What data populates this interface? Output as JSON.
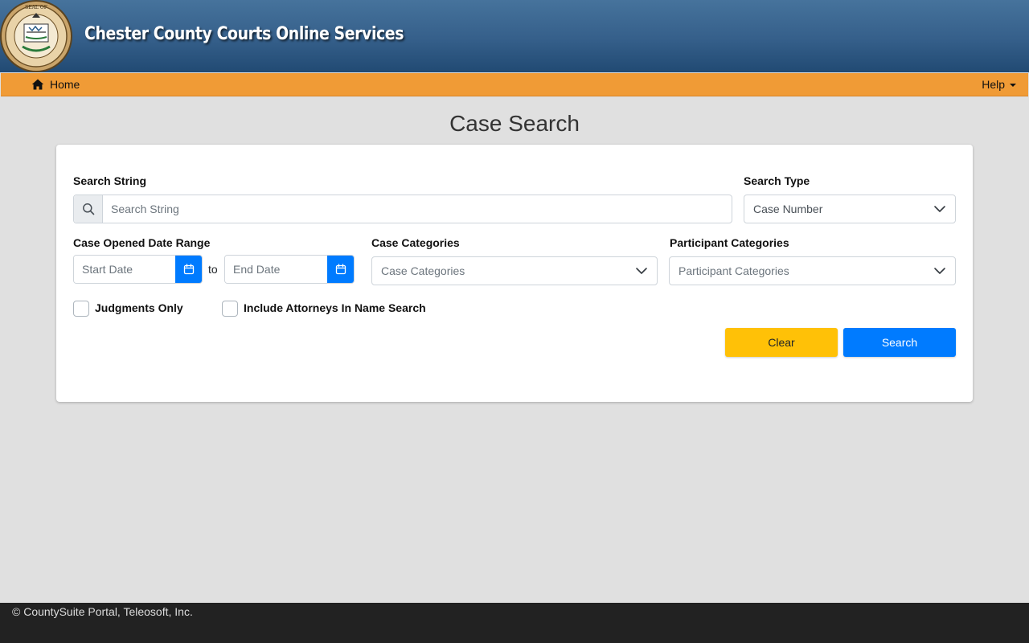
{
  "header": {
    "site_title": "Chester County Courts Online Services",
    "seal_text": "SEAL OF CHESTER COUNTY PENNSYLVANIA"
  },
  "navbar": {
    "home_label": "Home",
    "help_label": "Help",
    "home_icon": "home-icon"
  },
  "page": {
    "title": "Case Search"
  },
  "form": {
    "search_string_label": "Search String",
    "search_string_placeholder": "Search String",
    "search_type_label": "Search Type",
    "search_type_value": "Case Number",
    "date_range_label": "Case Opened Date Range",
    "start_date_placeholder": "Start Date",
    "to_label": "to",
    "end_date_placeholder": "End Date",
    "case_categories_label": "Case Categories",
    "case_categories_placeholder": "Case Categories",
    "participant_categories_label": "Participant Categories",
    "participant_categories_placeholder": "Participant Categories",
    "judgments_only_label": "Judgments Only",
    "judgments_only_checked": false,
    "include_attorneys_label": "Include Attorneys In Name Search",
    "include_attorneys_checked": false,
    "clear_label": "Clear",
    "search_label": "Search"
  },
  "footer": {
    "copyright": "© CountySuite Portal, Teleosoft, Inc."
  },
  "colors": {
    "header_blue": "#355f8a",
    "navbar_orange": "#f09b36",
    "primary_blue": "#007bff",
    "warning_yellow": "#ffc107",
    "footer_dark": "#222222"
  }
}
